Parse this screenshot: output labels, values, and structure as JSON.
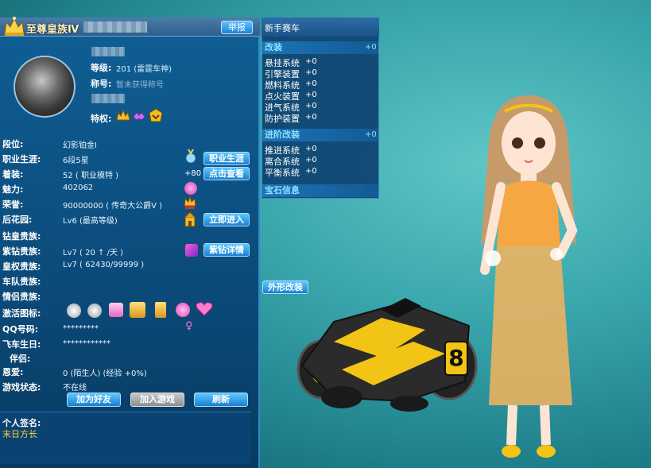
{
  "window": {
    "title": "至尊皇族Ⅳ",
    "report_button": "举报"
  },
  "profile": {
    "level_label": "等级:",
    "level_value": "201 (雷霆车神)",
    "title_label": "称号:",
    "title_value": "暂未获得称号",
    "privilege_label": "特权:"
  },
  "rows": [
    {
      "label": "段位:",
      "value": "幻影铂金Ⅰ"
    },
    {
      "label": "职业生涯:",
      "value": "6段5星"
    },
    {
      "label": "着装:",
      "value": "52 ( 职业模特 )"
    },
    {
      "label": "魅力:",
      "value": "402062"
    },
    {
      "label": "荣誉:",
      "value": "90000000 ( 传奇大公爵Ⅴ )"
    },
    {
      "label": "后花园:",
      "value": "Lv6 (最高等级)"
    },
    {
      "label": "钻皇贵族:",
      "value": ""
    },
    {
      "label": "紫钻贵族:",
      "value": "Lv7 ( 20 ↑ /天 )"
    },
    {
      "label": "皇权贵族:",
      "value": "Lv7 ( 62430/99999 )"
    },
    {
      "label": "车队贵族:",
      "value": ""
    },
    {
      "label": "情侣贵族:",
      "value": ""
    },
    {
      "label": "激活图标:",
      "value": ""
    },
    {
      "label": "QQ号码:",
      "value": "*********"
    },
    {
      "label": "飞车生日:",
      "value": "************"
    },
    {
      "label": "伴侣:",
      "value": ""
    },
    {
      "label": "恩爱:",
      "value": "0 (陌生人) (经验 +0%)"
    },
    {
      "label": "游戏状态:",
      "value": "不在线"
    }
  ],
  "buttons": {
    "career": "职业生涯",
    "view": "点击查看",
    "enter": "立即进入",
    "purple_detail": "紫钻详情",
    "add_friend": "加为好友",
    "join_game": "加入游戏",
    "refresh": "刷新",
    "appearance": "外形改装"
  },
  "outfit_bonus": "+80",
  "signature": {
    "label": "个人签名:",
    "text": "末日方长"
  },
  "stats": {
    "car_name": "新手赛车",
    "modify": {
      "title": "改装",
      "plus": "+0",
      "items": [
        {
          "name": "悬挂系统",
          "value": "+0"
        },
        {
          "name": "引擎装置",
          "value": "+0"
        },
        {
          "name": "燃料系统",
          "value": "+0"
        },
        {
          "name": "点火装置",
          "value": "+0"
        },
        {
          "name": "进气系统",
          "value": "+0"
        },
        {
          "name": "防护装置",
          "value": "+0"
        }
      ]
    },
    "advanced": {
      "title": "进阶改装",
      "plus": "+0",
      "items": [
        {
          "name": "推进系统",
          "value": "+0"
        },
        {
          "name": "离合系统",
          "value": "+0"
        },
        {
          "name": "平衡系统",
          "value": "+0"
        }
      ]
    },
    "gem_title": "宝石信息"
  },
  "kart": {
    "number": "8"
  },
  "colors": {
    "accent": "#1a7fd0",
    "kart_yellow": "#f2c415"
  }
}
